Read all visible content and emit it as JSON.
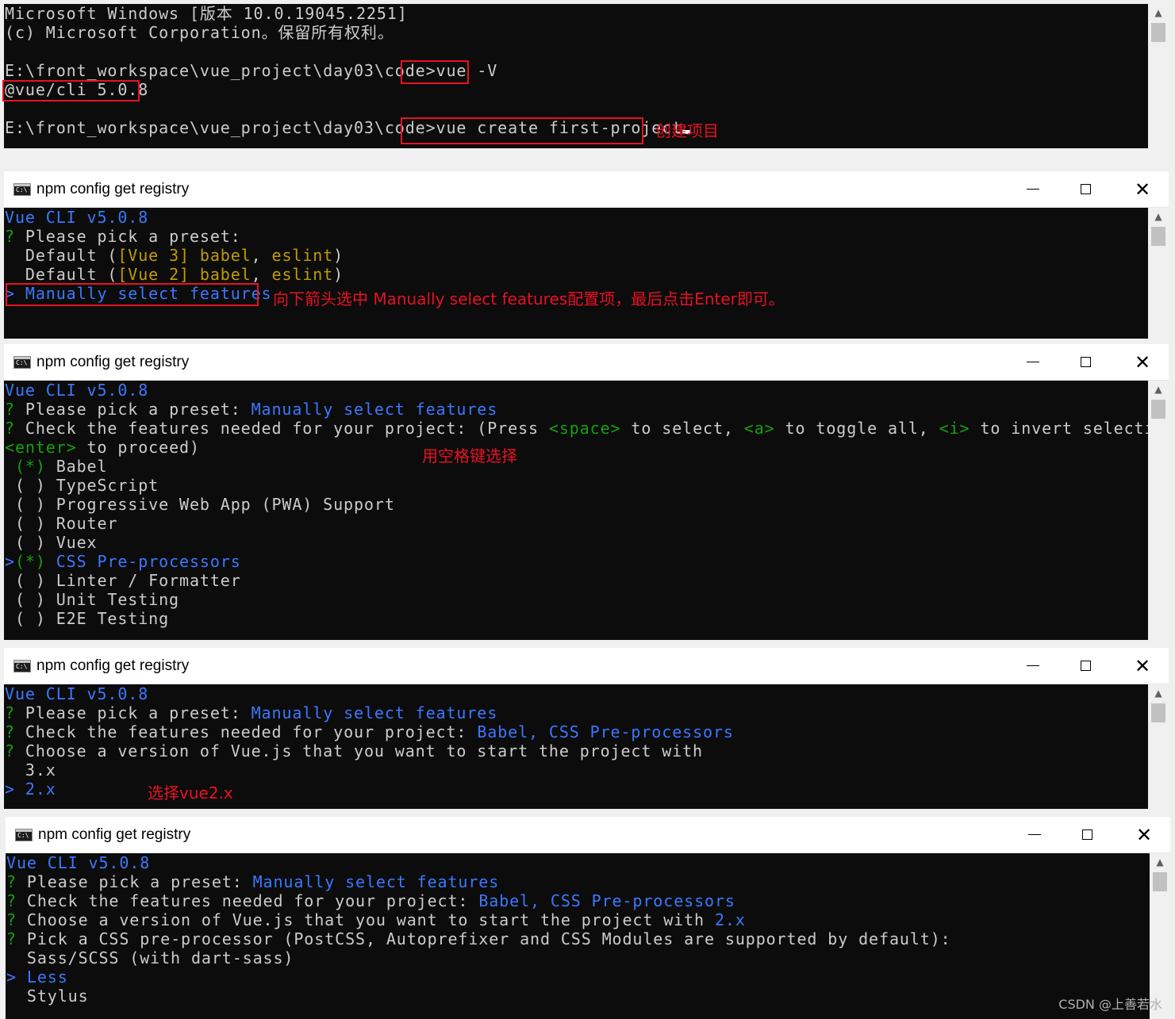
{
  "win1": {
    "lines": {
      "l1": "Microsoft Windows [版本 10.0.19045.2251]",
      "l2": "(c) Microsoft Corporation。保留所有权利。",
      "prompt": "E:\\front_workspace\\vue_project\\day03\\code>",
      "cmd1": "vue -V",
      "version": "@vue/cli 5.0.8",
      "cmd2": "vue create first-project"
    },
    "annotation": "创建项目"
  },
  "win2": {
    "title": "npm config get registry",
    "lines": {
      "header": "Vue CLI v5.0.8",
      "q": "?",
      "pick": " Please pick a preset:",
      "opt1a": "  Default (",
      "opt1b": "[Vue 3]",
      "opt1c": " babel",
      "opt1d": ", ",
      "opt1e": "eslint",
      "opt1f": ")",
      "opt2b": "[Vue 2]",
      "sel": "> Manually select features"
    },
    "annotation": "向下箭头选中 Manually select features配置项，最后点击Enter即可。"
  },
  "win3": {
    "title": "npm config get registry",
    "lines": {
      "header": "Vue CLI v5.0.8",
      "pick": " Please pick a preset: ",
      "manual": "Manually select features",
      "check": " Check the features needed for your project: (Press ",
      "space": "<space>",
      "toselect": " to select, ",
      "a": "<a>",
      "toggle": " to toggle all, ",
      "i": "<i>",
      "invert": " to invert selection, and",
      "enter": "<enter>",
      "proceed": " to proceed)",
      "f1_mark": " (*)",
      "f1": " Babel",
      "f2": " ( ) TypeScript",
      "f3": " ( ) Progressive Web App (PWA) Support",
      "f4": " ( ) Router",
      "f5": " ( ) Vuex",
      "f6_ptr": ">",
      "f6_mark": "(*)",
      "f6": " CSS Pre-processors",
      "f7": " ( ) Linter / Formatter",
      "f8": " ( ) Unit Testing",
      "f9": " ( ) E2E Testing"
    },
    "annotation": "用空格键选择"
  },
  "win4": {
    "title": "npm config get registry",
    "lines": {
      "header": "Vue CLI v5.0.8",
      "pick": " Please pick a preset: ",
      "manual": "Manually select features",
      "check": " Check the features needed for your project: ",
      "features": "Babel, CSS Pre-processors",
      "choose": " Choose a version of Vue.js that you want to start the project with",
      "v3": "  3.x",
      "v2": "> 2.x"
    },
    "annotation": "选择vue2.x"
  },
  "win5": {
    "title": "npm config get registry",
    "lines": {
      "header": "Vue CLI v5.0.8",
      "pick": " Please pick a preset: ",
      "manual": "Manually select features",
      "check": " Check the features needed for your project: ",
      "features": "Babel, CSS Pre-processors",
      "choose": " Choose a version of Vue.js that you want to start the project with ",
      "v2": "2.x",
      "css": " Pick a CSS pre-processor (PostCSS, Autoprefixer and CSS Modules are supported by default):",
      "sass": "  Sass/SCSS (with dart-sass)",
      "less": "> Less",
      "stylus": "  Stylus"
    }
  },
  "watermark": "CSDN @上善若水",
  "colors": {
    "blue": "#3b78ff",
    "green": "#13a10e",
    "yellow": "#c19c00",
    "red": "#e81123"
  }
}
